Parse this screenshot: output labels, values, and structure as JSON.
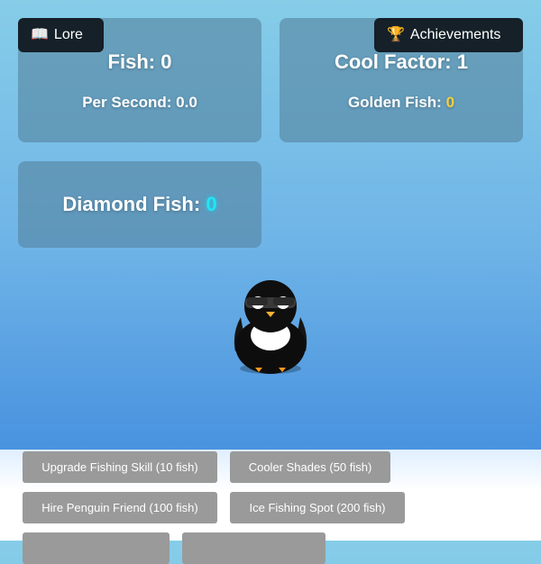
{
  "stats": {
    "fish": "Fish: 0",
    "per_second": "Per Second: 0.0",
    "cool_factor": "Cool Factor: 1",
    "golden_label": "Golden Fish: ",
    "golden_value": "0",
    "diamond_label": "Diamond Fish: ",
    "diamond_value": "0"
  },
  "buttons": {
    "lore_icon": "📖",
    "lore": "Lore",
    "achievements_icon": "🏆",
    "achievements": "Achievements"
  },
  "shop": {
    "items": [
      {
        "label": "Upgrade Fishing Skill (10 fish)"
      },
      {
        "label": "Cooler Shades (50 fish)"
      },
      {
        "label": "Hire Penguin Friend (100 fish)"
      },
      {
        "label": "Ice Fishing Spot (200 fish)"
      },
      {
        "label": ""
      },
      {
        "label": ""
      }
    ]
  },
  "colors": {
    "gold": "#f4d03f",
    "diamond": "#22e5f5",
    "button": "#9a9a9a"
  },
  "icons": {
    "penguin": "penguin-with-sunglasses"
  }
}
